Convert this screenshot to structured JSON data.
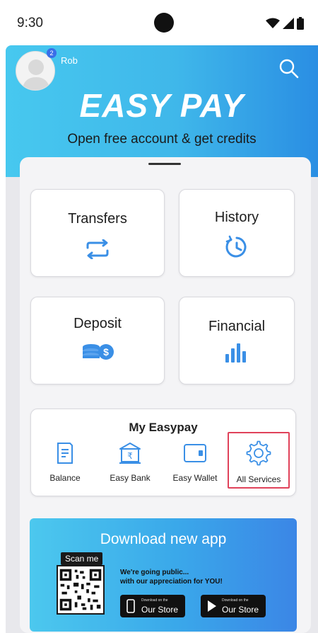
{
  "status": {
    "time": "9:30"
  },
  "header": {
    "user_name": "Rob",
    "badge_count": "2",
    "logo": "EASY PAY",
    "tagline": "Open free account & get credits"
  },
  "cards": {
    "transfers": "Transfers",
    "history": "History",
    "deposit": "Deposit",
    "financial": "Financial"
  },
  "my_easypay": {
    "title": "My Easypay",
    "items": [
      {
        "label": "Balance",
        "icon": "receipt-icon"
      },
      {
        "label": "Easy Bank",
        "icon": "bank-icon"
      },
      {
        "label": "Easy Wallet",
        "icon": "wallet-icon"
      },
      {
        "label": "All Services",
        "icon": "gear-icon"
      }
    ]
  },
  "banner": {
    "title": "Download new app",
    "scan_label": "Scan me",
    "text_line1": "We're going public...",
    "text_line2": "with our appreciation for YOU!",
    "store1_small": "Download on the",
    "store1_big": "Our Store",
    "store2_small": "Download on the",
    "store2_big": "Our Store"
  },
  "colors": {
    "accent": "#3a8fe6",
    "header_start": "#47c8ef",
    "header_end": "#2a8ee3",
    "highlight": "#e0425a"
  }
}
